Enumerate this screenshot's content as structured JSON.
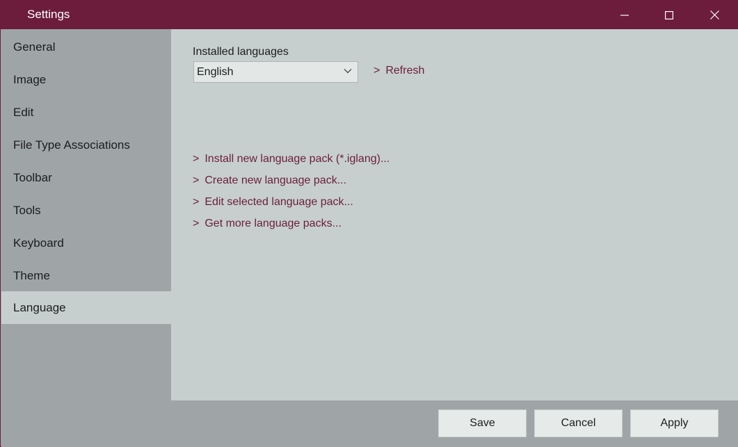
{
  "window": {
    "title": "Settings",
    "accent_color": "#6c1d3b"
  },
  "titlebar_controls": {
    "minimize_icon": "minimize-icon",
    "maximize_icon": "maximize-icon",
    "close_icon": "close-icon"
  },
  "sidebar": {
    "items": [
      {
        "label": "General",
        "active": false
      },
      {
        "label": "Image",
        "active": false
      },
      {
        "label": "Edit",
        "active": false
      },
      {
        "label": "File Type Associations",
        "active": false
      },
      {
        "label": "Toolbar",
        "active": false
      },
      {
        "label": "Tools",
        "active": false
      },
      {
        "label": "Keyboard",
        "active": false
      },
      {
        "label": "Theme",
        "active": false
      },
      {
        "label": "Language",
        "active": true
      }
    ]
  },
  "language": {
    "installed_label": "Installed languages",
    "selected_language": "English",
    "refresh_arrow": ">",
    "refresh_label": "Refresh",
    "links": [
      {
        "arrow": ">",
        "label": "Install new language pack (*.iglang)..."
      },
      {
        "arrow": ">",
        "label": "Create new language pack..."
      },
      {
        "arrow": ">",
        "label": "Edit selected language pack..."
      },
      {
        "arrow": ">",
        "label": "Get more language packs..."
      }
    ]
  },
  "footer": {
    "save_label": "Save",
    "cancel_label": "Cancel",
    "apply_label": "Apply"
  }
}
